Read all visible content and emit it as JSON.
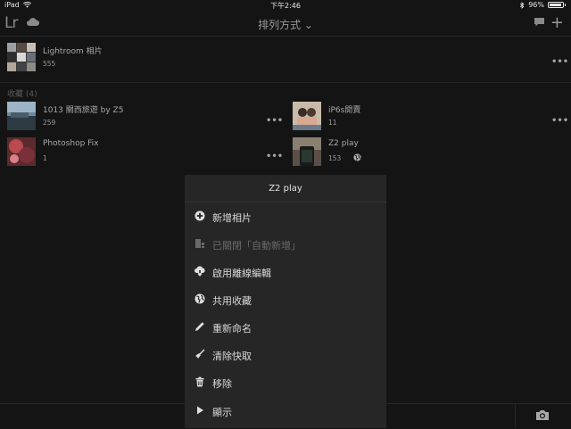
{
  "status": {
    "device": "iPad",
    "time": "下午2:46",
    "battery": "96%"
  },
  "nav": {
    "logo": "Lr",
    "sort_label": "排列方式 ⌄"
  },
  "all_photos": {
    "name": "Lightroom 相片",
    "count": "555"
  },
  "section_label": "收藏 (4)",
  "collections": [
    {
      "name": "1013 關西旅遊 by Z5",
      "count": "259"
    },
    {
      "name": "iP6s開賣",
      "count": "11"
    },
    {
      "name": "Photoshop Fix",
      "count": "1"
    },
    {
      "name": "Z2 play",
      "count": "153"
    }
  ],
  "menu": {
    "title": "Z2 play",
    "items": [
      {
        "label": "新增相片",
        "icon": "add-circle-icon",
        "enabled": true
      },
      {
        "label": "已關閉「自動新增」",
        "icon": "auto-add-off-icon",
        "enabled": false
      },
      {
        "label": "啟用離線編輯",
        "icon": "cloud-download-icon",
        "enabled": true
      },
      {
        "label": "共用收藏",
        "icon": "globe-icon",
        "enabled": true
      },
      {
        "label": "重新命名",
        "icon": "pencil-icon",
        "enabled": true
      },
      {
        "label": "清除快取",
        "icon": "broom-icon",
        "enabled": true
      },
      {
        "label": "移除",
        "icon": "trash-icon",
        "enabled": true
      },
      {
        "label": "顯示",
        "icon": "play-icon",
        "enabled": true
      }
    ]
  },
  "colors": {
    "background": "#141414",
    "menu_bg": "#262626",
    "text": "#d8d8d8",
    "muted": "#6a6a6a"
  }
}
